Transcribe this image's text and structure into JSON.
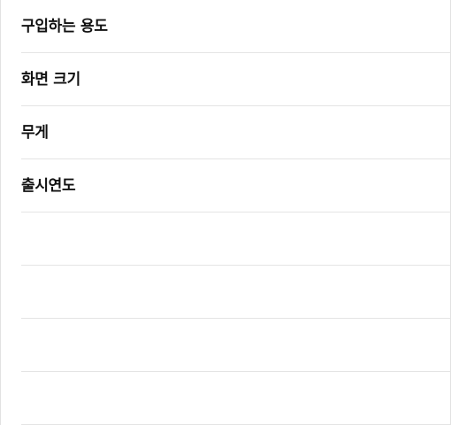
{
  "filter_panel": {
    "items": [
      {
        "label": "구입하는 용도"
      },
      {
        "label": "화면 크기"
      },
      {
        "label": "무게"
      },
      {
        "label": "출시연도"
      }
    ],
    "empty_rows": 4
  }
}
